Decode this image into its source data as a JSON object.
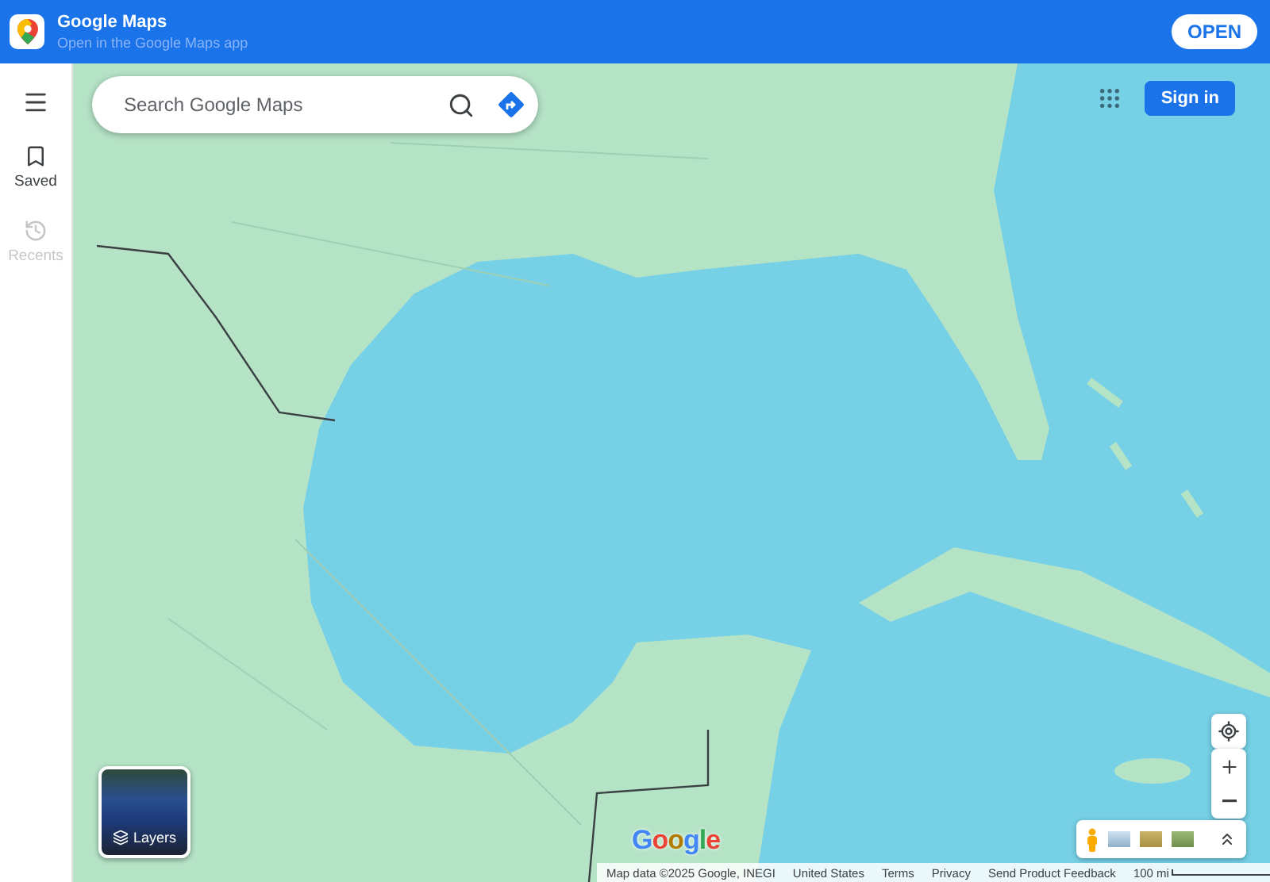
{
  "app_banner": {
    "title": "Google Maps",
    "subtitle": "Open in the Google Maps app",
    "open_button": "OPEN"
  },
  "sidebar": {
    "items": [
      {
        "kind": "menu"
      },
      {
        "kind": "saved",
        "label": "Saved",
        "disabled": false
      },
      {
        "kind": "recents",
        "label": "Recents",
        "disabled": true
      }
    ]
  },
  "search": {
    "placeholder": "Search Google Maps"
  },
  "sign_in": "Sign in",
  "layers": {
    "label": "Layers"
  },
  "map_logo": "Google",
  "footer": {
    "items": [
      "Map data ©2025 Google, INEGI",
      "United States",
      "Terms",
      "Privacy",
      "Send Product Feedback"
    ],
    "scale": "100 mi"
  }
}
